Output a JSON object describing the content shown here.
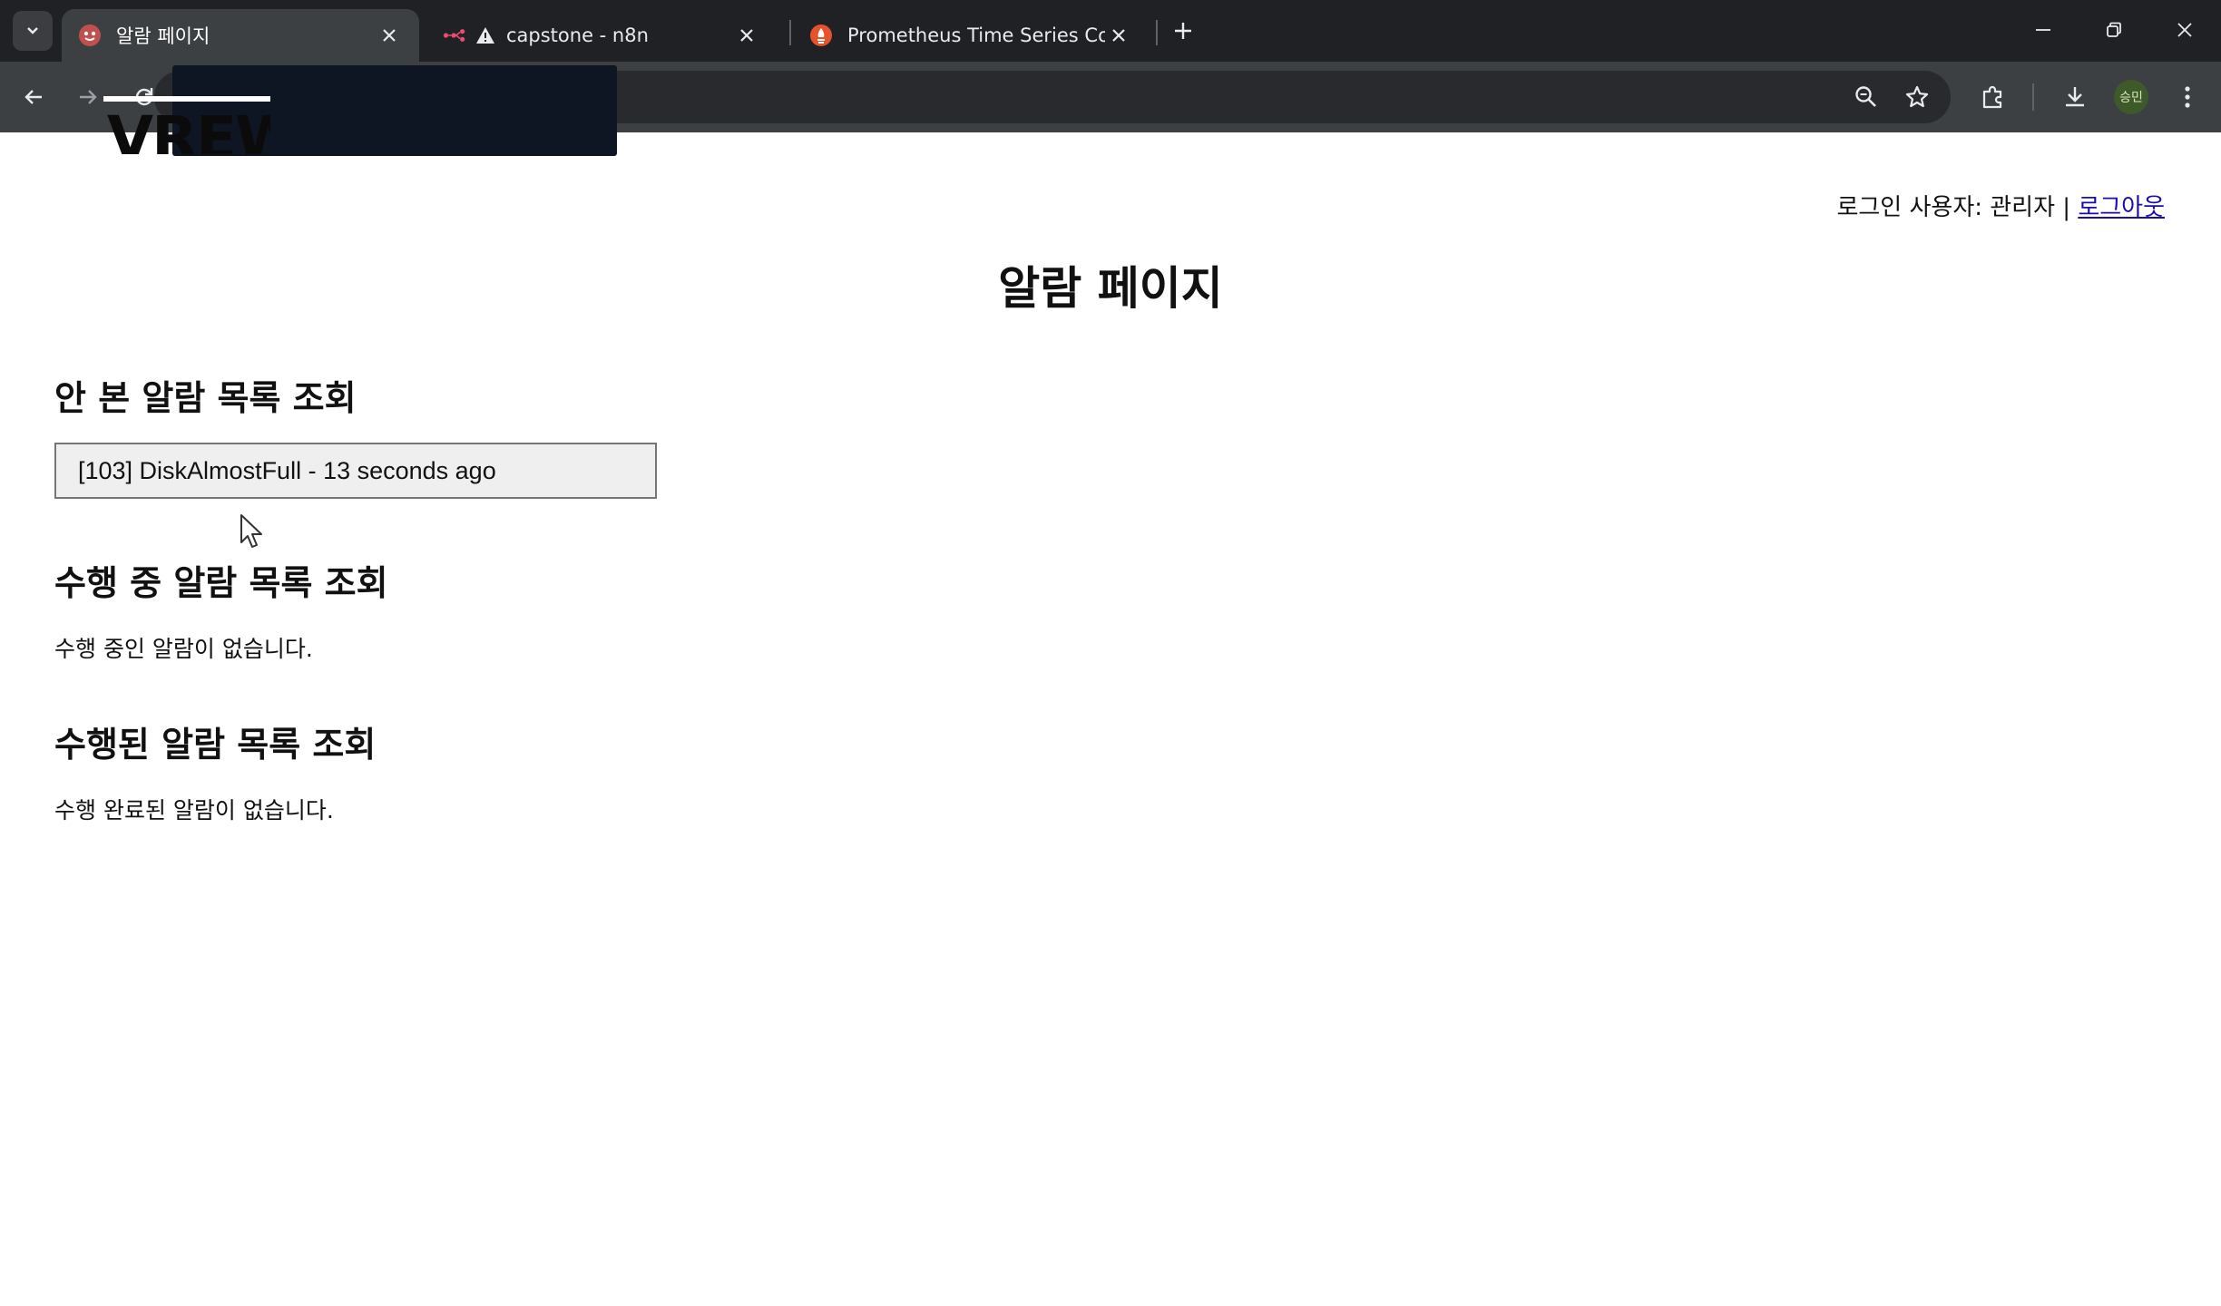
{
  "browser": {
    "tabs": [
      {
        "title": "알람 페이지",
        "active": true
      },
      {
        "title": "capstone - n8n",
        "active": false
      },
      {
        "title": "Prometheus Time Series Collec",
        "active": false
      }
    ],
    "profile_label": "승민",
    "icons": [
      "tab-list-icon",
      "close-icon",
      "new-tab-icon",
      "minimize-icon",
      "restore-icon",
      "back-icon",
      "forward-icon",
      "reload-icon",
      "zoom-icon",
      "star-icon",
      "extensions-icon",
      "download-icon",
      "menu-icon"
    ]
  },
  "overlay": {
    "logo_text": "VREW"
  },
  "header": {
    "login_prefix": "로그인 사용자: 관리자 | ",
    "logout_label": "로그아웃"
  },
  "page": {
    "title": "알람 페이지"
  },
  "sections": {
    "unseen": {
      "title": "안 본 알람 목록 조회",
      "items": [
        "[103] DiskAlmostFull - 13 seconds ago"
      ]
    },
    "in_progress": {
      "title": "수행 중 알람 목록 조회",
      "empty_message": "수행 중인 알람이 없습니다."
    },
    "done": {
      "title": "수행된 알람 목록 조회",
      "empty_message": "수행 완료된 알람이 없습니다."
    }
  },
  "colors": {
    "chrome_bg": "#202124",
    "toolbar_bg": "#3c4043",
    "link": "#1a0dab",
    "alarm_item_bg": "#efefef"
  }
}
